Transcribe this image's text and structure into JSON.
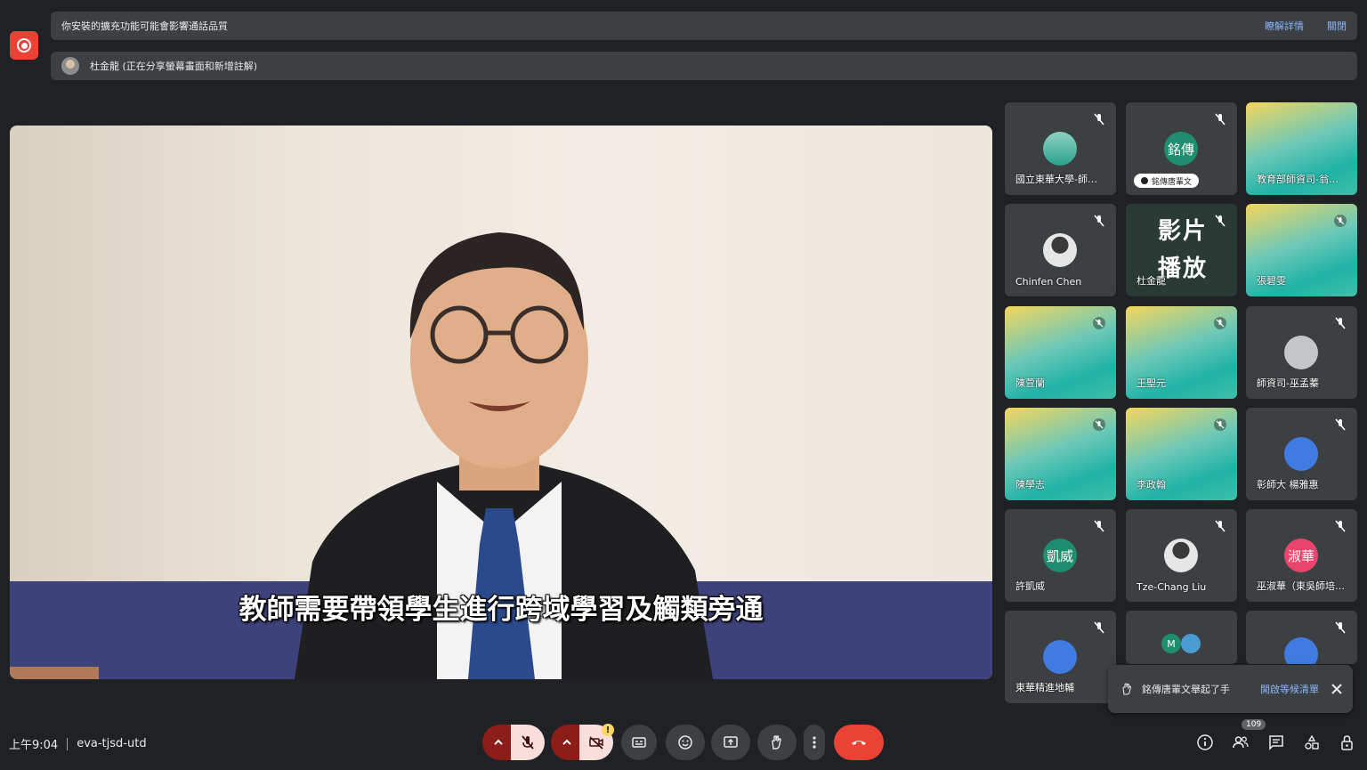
{
  "banners": {
    "extension_warning": "你安裝的擴充功能可能會影響通話品質",
    "learn_more": "瞭解詳情",
    "close": "關閉",
    "presenting": "杜金龍 (正在分享螢幕畫面和新增註解)"
  },
  "main_video": {
    "caption": "教師需要帶領學生進行跨域學習及觸類旁通"
  },
  "participants": [
    {
      "name": "國立東華大學-師…",
      "avatar_type": "logo",
      "muted": true
    },
    {
      "name": "銘傳唐輩文",
      "avatar_text": "銘傳",
      "muted": true,
      "hand_raised": true
    },
    {
      "name": "教育部師資司-翁…",
      "tile_type": "video",
      "muted": false
    },
    {
      "name": "Chinfen Chen",
      "avatar_type": "photo",
      "muted": true
    },
    {
      "name": "杜金龍",
      "tile_type": "screen",
      "screen_text": "影片播放",
      "muted": true
    },
    {
      "name": "張碧雯",
      "tile_type": "video",
      "muted": true
    },
    {
      "name": "陳萱蘭",
      "tile_type": "video",
      "muted": true
    },
    {
      "name": "王聖元",
      "tile_type": "video",
      "muted": true
    },
    {
      "name": "師資司-巫孟蓁",
      "avatar_type": "default",
      "muted": true
    },
    {
      "name": "陳學志",
      "tile_type": "video",
      "muted": true
    },
    {
      "name": "李政翰",
      "tile_type": "video",
      "muted": true
    },
    {
      "name": "彰師大 楊雅惠",
      "avatar_type": "blue",
      "muted": true
    },
    {
      "name": "許凱威",
      "avatar_text": "凱威",
      "muted": true
    },
    {
      "name": "Tze-Chang Liu",
      "avatar_type": "photo",
      "muted": true
    },
    {
      "name": "巫淑華（東吳師培…",
      "avatar_text": "淑華",
      "muted": true
    },
    {
      "name": "東華精進地輔",
      "avatar_type": "blue",
      "muted": true
    },
    {
      "name": "",
      "avatar_text": "M",
      "muted": false
    },
    {
      "name": "",
      "avatar_type": "blue",
      "muted": true
    }
  ],
  "toast": {
    "message": "銘傳唐輩文舉起了手",
    "action": "開啟等候清單"
  },
  "meeting": {
    "time": "上午9:04",
    "code": "eva-tjsd-utd"
  },
  "participant_count": "109",
  "colors": {
    "end_call": "#ea4335",
    "muted_red": "#8c1d18",
    "link": "#8ab4f8",
    "background": "#202124"
  }
}
